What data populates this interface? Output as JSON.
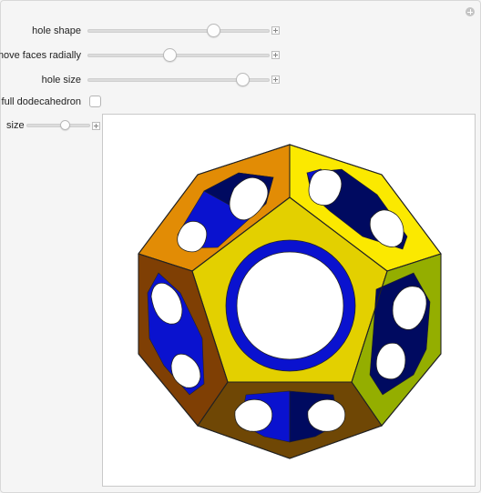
{
  "controls": {
    "hole_shape": {
      "label": "hole shape",
      "value": 0.69
    },
    "move_faces_radially": {
      "label": "move faces radially",
      "value": 0.45
    },
    "hole_size": {
      "label": "hole size",
      "value": 0.85
    },
    "full_dodecahedron": {
      "label": "full dodecahedron",
      "checked": false
    },
    "size": {
      "label": "size",
      "value": 0.6
    }
  },
  "colors": {
    "front_face": "#e3d000",
    "top_left_face": "#e28c05",
    "top_right_face": "#fbe900",
    "right_face": "#94ae00",
    "left_face": "#7f3f04",
    "bottom_face": "#6f4705",
    "inner_blue": "#0a12cf",
    "inner_dark": "#000a60",
    "frame_line": "#222222"
  },
  "icons": [
    "plus-icon",
    "plus-icon",
    "plus-icon",
    "plus-icon",
    "circle-plus-icon"
  ]
}
